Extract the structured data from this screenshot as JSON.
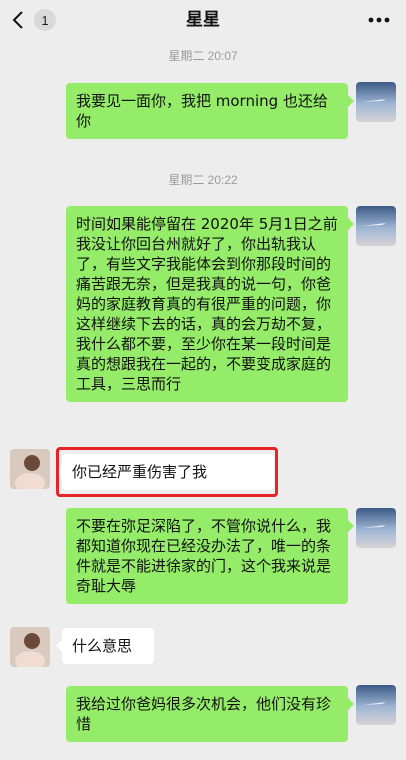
{
  "header": {
    "title": "星星",
    "unread_count": "1"
  },
  "timestamps": [
    "星期二 20:07",
    "星期二 20:22"
  ],
  "messages": [
    {
      "side": "out",
      "text": "我要见一面你，我把 morning 也还给你"
    },
    {
      "side": "out",
      "text": "时间如果能停留在 2020年 5月1日之前我没让你回台州就好了，你出轨我认了，有些文字我能体会到你那段时间的痛苦跟无奈，但是我真的说一句，你爸妈的家庭教育真的有很严重的问题，你这样继续下去的话，真的会万劫不复，我什么都不要，至少你在某一段时间是真的想跟我在一起的，不要变成家庭的工具，三思而行"
    },
    {
      "side": "in",
      "text": "你已经严重伤害了我"
    },
    {
      "side": "out",
      "text": "不要在弥足深陷了，不管你说什么，我都知道你现在已经没办法了，唯一的条件就是不能进徐家的门，这个我来说是奇耻大辱"
    },
    {
      "side": "in",
      "text": "什么意思"
    },
    {
      "side": "out",
      "text": "我给过你爸妈很多次机会，他们没有珍惜"
    }
  ],
  "colors": {
    "background": "#ededed",
    "outgoing_bubble": "#95ec69",
    "incoming_bubble": "#ffffff",
    "highlight": "#e8232a"
  }
}
